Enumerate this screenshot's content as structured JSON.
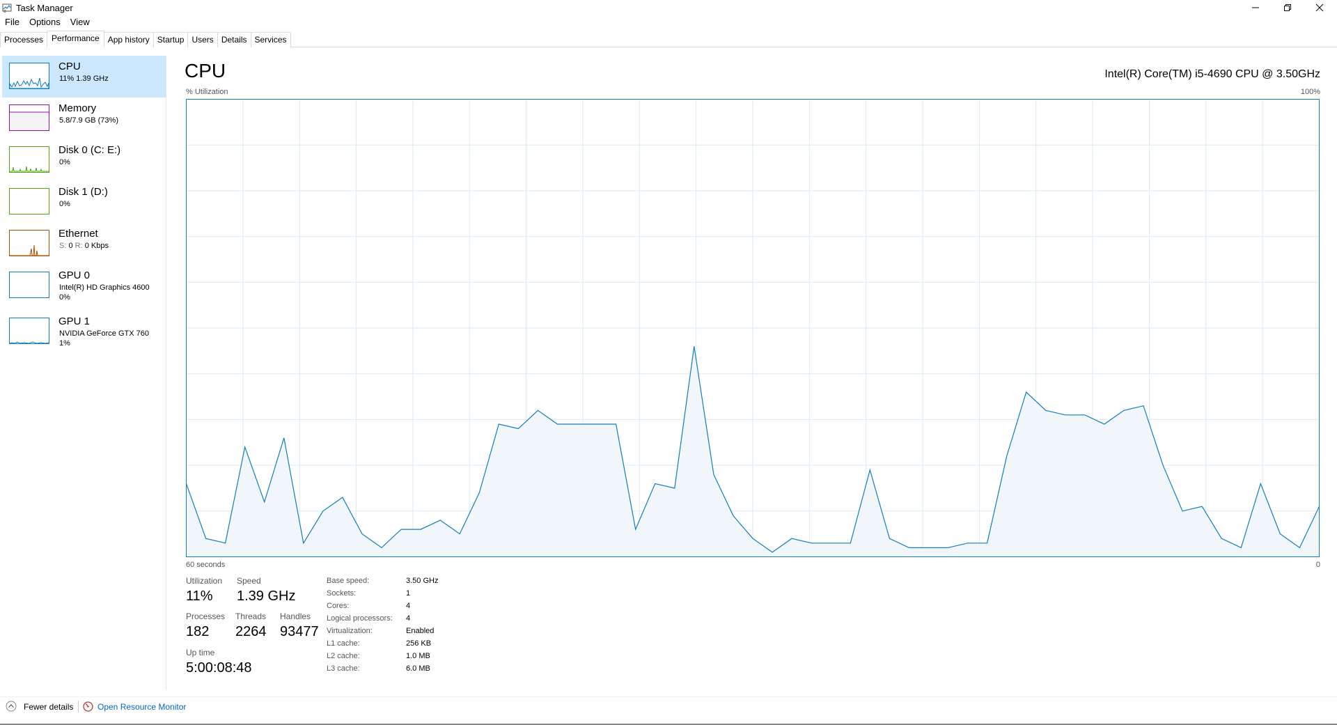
{
  "window": {
    "title": "Task Manager"
  },
  "menu": [
    "File",
    "Options",
    "View"
  ],
  "tabs": [
    {
      "label": "Processes",
      "active": false
    },
    {
      "label": "Performance",
      "active": true
    },
    {
      "label": "App history",
      "active": false
    },
    {
      "label": "Startup",
      "active": false
    },
    {
      "label": "Users",
      "active": false
    },
    {
      "label": "Details",
      "active": false
    },
    {
      "label": "Services",
      "active": false
    }
  ],
  "sidebar": {
    "items": [
      {
        "title": "CPU",
        "sub": "11%  1.39 GHz",
        "color": "#117dbb",
        "fill": "#f1f6fa",
        "selected": true
      },
      {
        "title": "Memory",
        "sub": "5.8/7.9 GB (73%)",
        "color": "#8b12ae",
        "fill": "#f4f2f4",
        "selected": false
      },
      {
        "title": "Disk 0 (C: E:)",
        "sub": "0%",
        "color": "#4da60c",
        "fill": "#eff7ea",
        "selected": false
      },
      {
        "title": "Disk 1 (D:)",
        "sub": "0%",
        "color": "#4da60c",
        "fill": "#eff7ea",
        "selected": false
      },
      {
        "title": "Ethernet",
        "sub_send": "S:",
        "sub_send_value": "0",
        "sub_recv": "R:",
        "sub_recv_value": "0 Kbps",
        "color": "#a74f01",
        "fill": "#fcf3eb",
        "selected": false
      },
      {
        "title": "GPU 0",
        "sub": "Intel(R) HD Graphics 4600",
        "sub2": "0%",
        "color": "#117dbb",
        "fill": "#f1f6fa",
        "selected": false
      },
      {
        "title": "GPU 1",
        "sub": "NVIDIA GeForce GTX 760",
        "sub2": "1%",
        "color": "#117dbb",
        "fill": "#f1f6fa",
        "selected": false
      }
    ]
  },
  "main": {
    "title": "CPU",
    "cpu_name": "Intel(R) Core(TM) i5-4690 CPU @ 3.50GHz",
    "y_axis_label": "% Utilization",
    "y_axis_max": "100%",
    "x_axis_label": "60 seconds",
    "x_axis_min": "0"
  },
  "chart_data": {
    "type": "area",
    "title": "CPU",
    "xlabel": "60 seconds",
    "ylabel": "% Utilization",
    "xlim": [
      60,
      0
    ],
    "ylim": [
      0,
      100
    ],
    "grid": true,
    "color": "#117dbb",
    "fill": "#f1f6fa",
    "values": [
      16,
      4,
      3,
      24,
      12,
      26,
      3,
      10,
      13,
      5,
      2,
      6,
      6,
      8,
      5,
      14,
      29,
      28,
      32,
      29,
      29,
      29,
      29,
      6,
      16,
      15,
      46,
      18,
      9,
      4,
      1,
      4,
      3,
      3,
      3,
      19,
      4,
      2,
      2,
      2,
      3,
      3,
      22,
      36,
      32,
      31,
      31,
      29,
      32,
      33,
      20,
      10,
      11,
      4,
      2,
      16,
      5,
      2,
      11
    ]
  },
  "stats": {
    "utilization": {
      "label": "Utilization",
      "value": "11%"
    },
    "speed": {
      "label": "Speed",
      "value": "1.39 GHz"
    },
    "processes": {
      "label": "Processes",
      "value": "182"
    },
    "threads": {
      "label": "Threads",
      "value": "2264"
    },
    "handles": {
      "label": "Handles",
      "value": "93477"
    },
    "uptime": {
      "label": "Up time",
      "value": "5:00:08:48"
    }
  },
  "specs": [
    {
      "label": "Base speed:",
      "value": "3.50 GHz"
    },
    {
      "label": "Sockets:",
      "value": "1"
    },
    {
      "label": "Cores:",
      "value": "4"
    },
    {
      "label": "Logical processors:",
      "value": "4"
    },
    {
      "label": "Virtualization:",
      "value": "Enabled"
    },
    {
      "label": "L1 cache:",
      "value": "256 KB"
    },
    {
      "label": "L2 cache:",
      "value": "1.0 MB"
    },
    {
      "label": "L3 cache:",
      "value": "6.0 MB"
    }
  ],
  "footer": {
    "fewer_details": "Fewer details",
    "open_resource_monitor": "Open Resource Monitor"
  }
}
